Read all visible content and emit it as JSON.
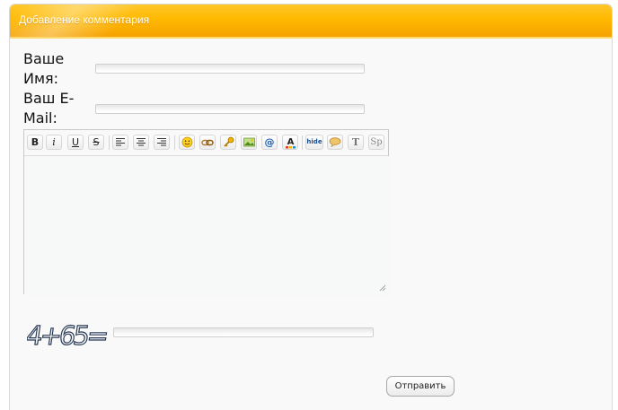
{
  "panel": {
    "title": "Добавление комментария",
    "accent_color": "#ffb900"
  },
  "form": {
    "name_label": "Ваше Имя:",
    "email_label": "Ваш E-Mail:",
    "name_value": "",
    "email_value": "",
    "comment_value": "",
    "captcha_answer": "",
    "submit_label": "Отправить"
  },
  "toolbar": {
    "bold": "B",
    "italic": "i",
    "underline": "U",
    "strike": "S",
    "hide": "hide",
    "translit": "T",
    "spoiler": "Sp",
    "icons": [
      "bold-icon",
      "italic-icon",
      "underline-icon",
      "strike-icon",
      "align-left-icon",
      "align-center-icon",
      "align-right-icon",
      "smiley-icon",
      "link-icon",
      "key-icon",
      "image-icon",
      "email-icon",
      "font-color-icon",
      "hide-icon",
      "quote-icon",
      "translit-icon",
      "spoiler-icon"
    ]
  },
  "captcha": {
    "text": "4+65="
  }
}
